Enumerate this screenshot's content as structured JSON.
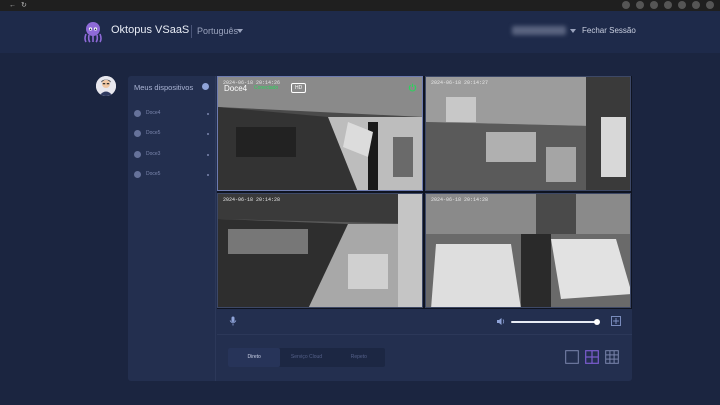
{
  "header": {
    "brand": "Oktopus VSaaS",
    "language": "Português",
    "logout": "Fechar Sessão"
  },
  "sidebar": {
    "title": "Meus dispositivos",
    "devices": [
      {
        "name": "Doce4"
      },
      {
        "name": "Doce5"
      },
      {
        "name": "Doce3"
      },
      {
        "name": "Doce5"
      }
    ]
  },
  "cameras": [
    {
      "timestamp": "2024-06-18 20:14:26"
    },
    {
      "timestamp": "2024-06-18 20:14:27"
    },
    {
      "timestamp": "2024-06-18 20:14:28"
    },
    {
      "timestamp": "2024-06-18 20:14:28"
    }
  ],
  "selected_camera": {
    "name": "Doce4",
    "status": "Conectado",
    "quality": "HD"
  },
  "controls": {
    "volume_percent": 98
  },
  "tabs": [
    {
      "label": "Direto",
      "active": true
    },
    {
      "label": "Serviço Cloud",
      "active": false
    },
    {
      "label": "Repeto",
      "active": false
    }
  ],
  "colors": {
    "accent": "#7b5ccf",
    "status_online": "#2bd45c",
    "background": "#1b2540",
    "panel": "#232f4f"
  }
}
